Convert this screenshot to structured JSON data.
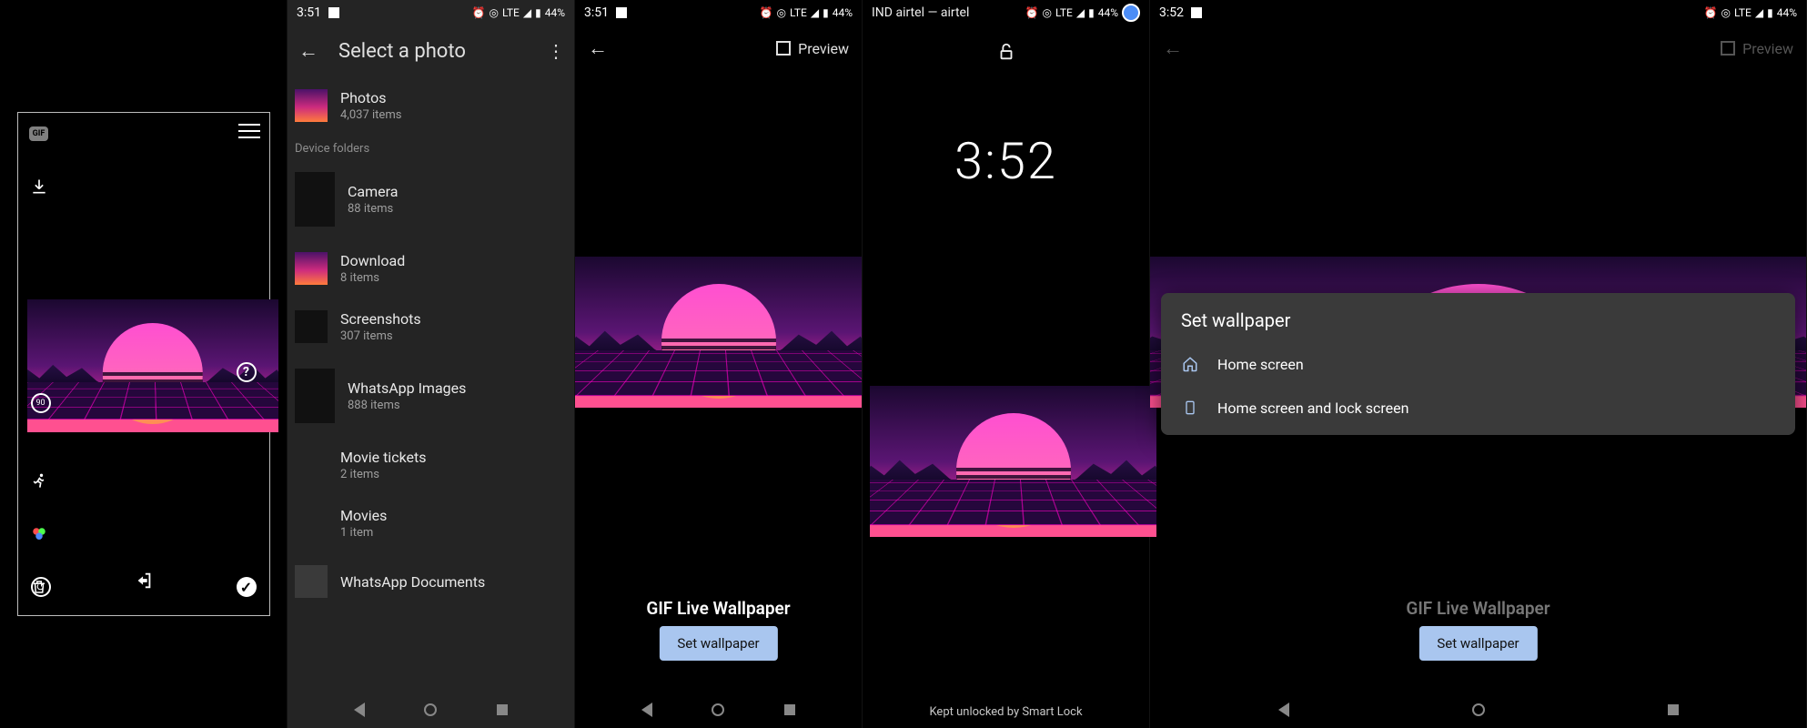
{
  "status": {
    "time1": "3:51",
    "time2": "3:51",
    "time3": "3:52",
    "battery": "44%",
    "net": "LTE"
  },
  "panel1": {
    "gif_label": "GIF",
    "rotate_label": "90"
  },
  "panel2": {
    "title": "Select a photo",
    "section_label": "Device folders",
    "folders": [
      {
        "name": "Photos",
        "count": "4,037 items"
      },
      {
        "name": "Camera",
        "count": "88 items"
      },
      {
        "name": "Download",
        "count": "8 items"
      },
      {
        "name": "Screenshots",
        "count": "307 items"
      },
      {
        "name": "WhatsApp Images",
        "count": "888 items"
      },
      {
        "name": "Movie tickets",
        "count": "2 items"
      },
      {
        "name": "Movies",
        "count": "1 item"
      },
      {
        "name": "WhatsApp Documents",
        "count": ""
      }
    ]
  },
  "panel3": {
    "preview": "Preview",
    "caption": "GIF Live Wallpaper",
    "button": "Set wallpaper"
  },
  "panel4": {
    "carrier": "IND airtel — airtel",
    "clock": "3:52",
    "smartlock": "Kept unlocked by Smart Lock"
  },
  "panel5": {
    "preview": "Preview",
    "caption": "GIF Live Wallpaper",
    "button": "Set wallpaper",
    "sheet_title": "Set wallpaper",
    "option_home": "Home screen",
    "option_both": "Home screen and lock screen"
  }
}
